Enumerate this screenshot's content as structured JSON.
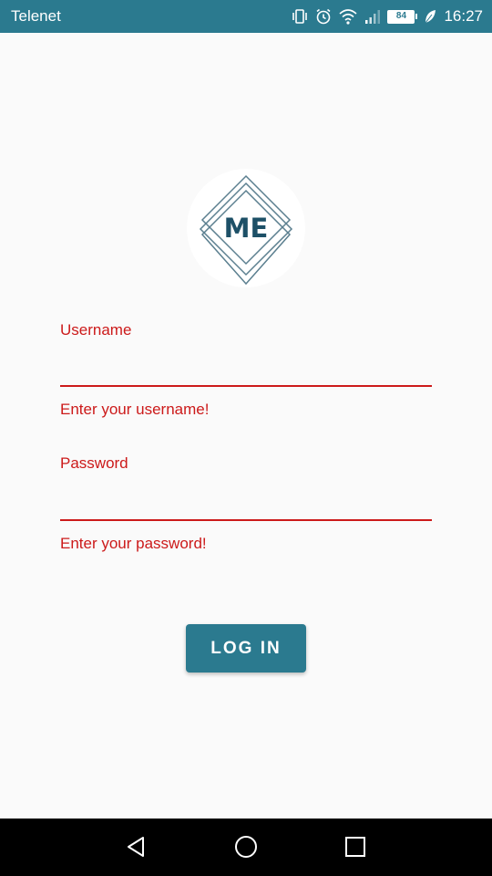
{
  "status_bar": {
    "carrier": "Telenet",
    "battery": "84",
    "time": "16:27",
    "icons": [
      "vibrate-icon",
      "alarm-icon",
      "wifi-icon",
      "signal-icon",
      "battery-icon",
      "leaf-icon"
    ],
    "background_color": "#2b7a8f"
  },
  "logo": {
    "text": "ME",
    "icon": "me-logo-icon",
    "color": "#1d5067"
  },
  "form": {
    "username": {
      "label": "Username",
      "value": "",
      "error": "Enter your username!"
    },
    "password": {
      "label": "Password",
      "value": "",
      "error": "Enter your password!"
    },
    "error_color": "#cc1a1a"
  },
  "login_button": {
    "label": "LOG IN",
    "color": "#2b7a8f"
  },
  "nav_bar": {
    "items": [
      "back-icon",
      "home-icon",
      "recents-icon"
    ]
  }
}
